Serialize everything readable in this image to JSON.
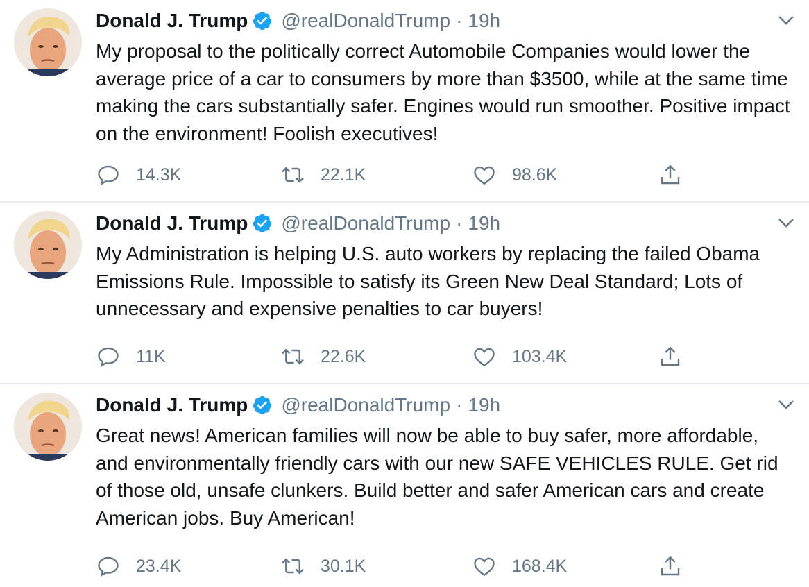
{
  "colors": {
    "verified_badge": "#1da1f2",
    "secondary_text": "#657786",
    "primary_text": "#14171a",
    "divider": "#e6ecf0"
  },
  "tweets": [
    {
      "display_name": "Donald J. Trump",
      "handle": "@realDonaldTrump",
      "separator": "·",
      "time": "19h",
      "text": "My proposal to the politically correct Automobile Companies would lower the average price of a car to consumers by more than $3500, while at the same time making the cars substantially safer. Engines would run smoother. Positive impact on the environment! Foolish executives!",
      "replies": "14.3K",
      "retweets": "22.1K",
      "likes": "98.6K",
      "icons": [
        "avatar",
        "verified-badge-icon",
        "chevron-down-icon",
        "reply-icon",
        "retweet-icon",
        "like-icon",
        "share-icon"
      ]
    },
    {
      "display_name": "Donald J. Trump",
      "handle": "@realDonaldTrump",
      "separator": "·",
      "time": "19h",
      "text": "My Administration is helping U.S. auto workers by replacing the failed Obama Emissions Rule. Impossible to satisfy its Green New Deal Standard; Lots of unnecessary and expensive penalties to car buyers!",
      "replies": "11K",
      "retweets": "22.6K",
      "likes": "103.4K",
      "icons": [
        "avatar",
        "verified-badge-icon",
        "chevron-down-icon",
        "reply-icon",
        "retweet-icon",
        "like-icon",
        "share-icon"
      ]
    },
    {
      "display_name": "Donald J. Trump",
      "handle": "@realDonaldTrump",
      "separator": "·",
      "time": "19h",
      "text": "Great news! American families will now be able to buy safer, more affordable, and environmentally friendly cars with our new SAFE VEHICLES RULE. Get rid of those old, unsafe clunkers. Build better and safer American cars and create American jobs. Buy American!",
      "replies": "23.4K",
      "retweets": "30.1K",
      "likes": "168.4K",
      "icons": [
        "avatar",
        "verified-badge-icon",
        "chevron-down-icon",
        "reply-icon",
        "retweet-icon",
        "like-icon",
        "share-icon"
      ]
    }
  ]
}
